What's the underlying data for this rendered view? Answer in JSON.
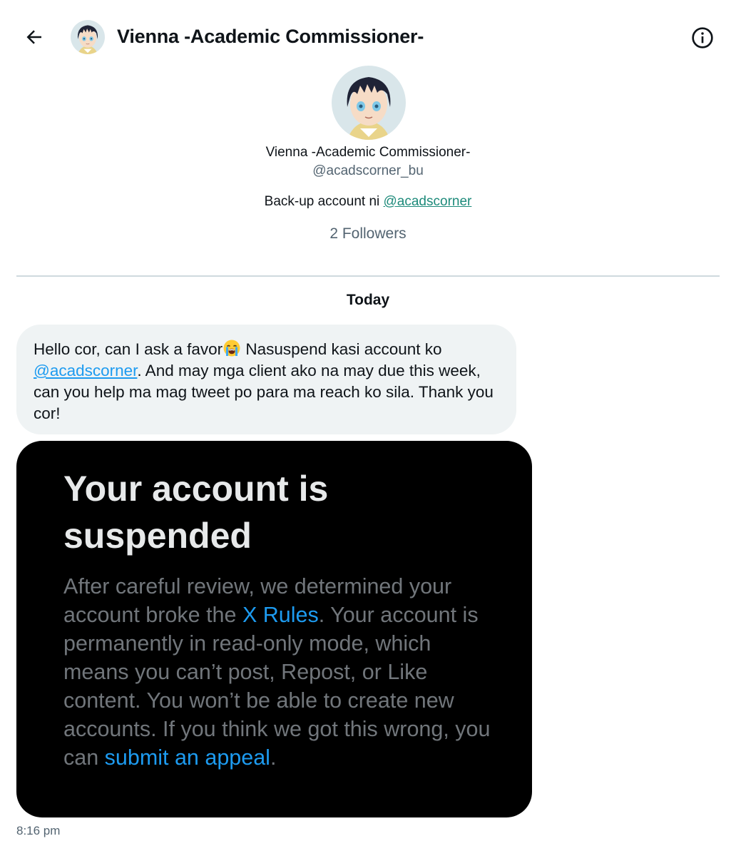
{
  "header": {
    "title": "Vienna -Academic Commissioner-",
    "back_icon": "arrow-left-icon",
    "info_icon": "info-circle-icon"
  },
  "profile": {
    "name": "Vienna -Academic Commissioner-",
    "handle": "@acadscorner_bu",
    "bio_prefix": "Back-up account ni ",
    "bio_mention": "@acadscorner",
    "followers": "2 Followers"
  },
  "conversation": {
    "day_label": "Today",
    "message": {
      "text_1": "Hello cor, can I ask a favor",
      "emoji": "loudly-crying-face-emoji",
      "text_2": " Nasuspend kasi account ko ",
      "mention": "@acadscorner",
      "text_3": ". And may mga client ako na may due this week, can you help ma mag tweet po para ma reach ko sila. Thank you cor!"
    },
    "media": {
      "heading": "Your account is suspended",
      "body_1": "After careful review, we determined your account broke the ",
      "link_1": "X Rules",
      "body_2": ". Your account is permanently in read-only mode, which means you can’t post, Repost, or Like content. You won’t be able to create new accounts. If you think we got this wrong, you can ",
      "link_2": "submit an appeal",
      "body_3": "."
    },
    "timestamp": "8:16 pm"
  },
  "colors": {
    "link_blue": "#1d9bf0",
    "bio_link_teal": "#1d8a7a",
    "bubble_bg": "#eff3f4",
    "secondary_text": "#536471",
    "media_bg": "#000000"
  }
}
